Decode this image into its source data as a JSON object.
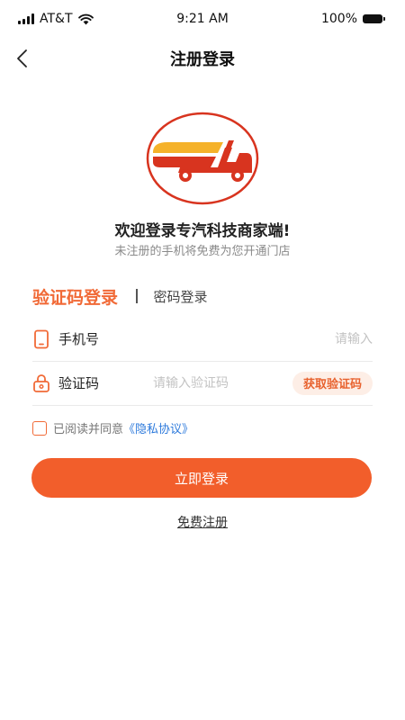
{
  "status_bar": {
    "carrier": "AT&T",
    "time": "9:21 AM",
    "battery": "100%"
  },
  "nav": {
    "title": "注册登录",
    "back_icon": "chevron-left-icon"
  },
  "logo": {
    "icon": "truck-logo-icon",
    "colors": {
      "ring": "#d8341f",
      "cab": "#d8341f",
      "stripe_top": "#f5b22a",
      "stripe_bottom": "#d8341f"
    }
  },
  "welcome": {
    "title": "欢迎登录专汽科技商家端!",
    "subtitle": "未注册的手机将免费为您开通门店"
  },
  "tabs": {
    "active": "验证码登录",
    "inactive": "密码登录"
  },
  "form": {
    "phone": {
      "label": "手机号",
      "placeholder": "请输入",
      "value": "",
      "icon": "phone-icon"
    },
    "code": {
      "label": "验证码",
      "placeholder": "请输入验证码",
      "value": "",
      "icon": "lock-icon"
    },
    "get_code_label": "获取验证码"
  },
  "agreement": {
    "checked": false,
    "text": "已阅读并同意",
    "link": "《隐私协议》"
  },
  "actions": {
    "login_label": "立即登录",
    "register_label": "免费注册"
  },
  "colors": {
    "accent": "#f25e2b",
    "tab_active": "#f16a37",
    "link": "#2f7bdc"
  }
}
